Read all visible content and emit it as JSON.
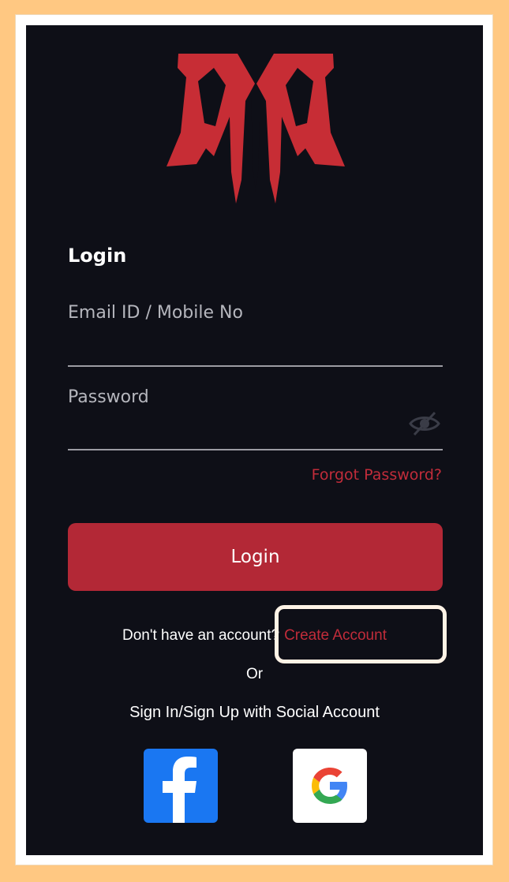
{
  "logo": {
    "name": "AA-logo",
    "color": "#c72d35"
  },
  "login": {
    "title": "Login",
    "email_placeholder": "Email ID / Mobile No",
    "password_placeholder": "Password",
    "forgot_label": "Forgot Password?",
    "button_label": "Login"
  },
  "signup": {
    "question": "Don't have an account?",
    "link_label": "Create Account"
  },
  "or_label": "Or",
  "social": {
    "prompt": "Sign In/Sign Up with Social Account",
    "providers": [
      {
        "name": "facebook",
        "icon": "facebook-icon",
        "color": "#1a77f2"
      },
      {
        "name": "google",
        "icon": "google-icon",
        "color": "#ffffff"
      }
    ]
  },
  "colors": {
    "background": "#0e0f17",
    "accent": "#b32836",
    "link": "#c12c3a"
  }
}
